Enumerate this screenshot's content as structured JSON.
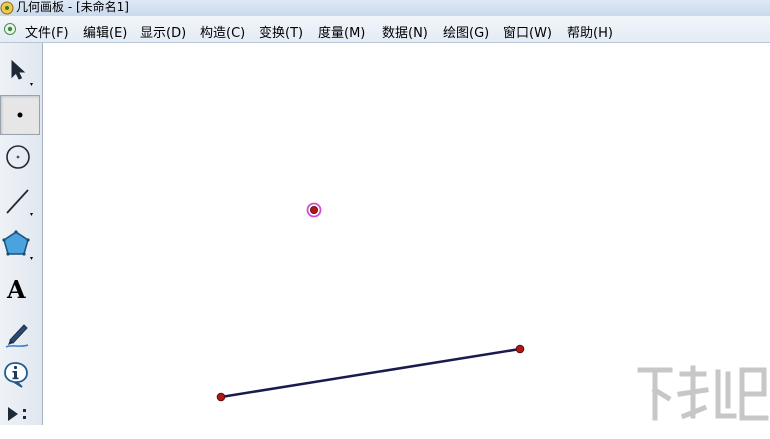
{
  "window": {
    "title": "几何画板 - [未命名1]"
  },
  "menu": {
    "items": [
      {
        "label": "文件(F)"
      },
      {
        "label": "编辑(E)"
      },
      {
        "label": "显示(D)"
      },
      {
        "label": "构造(C)"
      },
      {
        "label": "变换(T)"
      },
      {
        "label": "度量(M)"
      },
      {
        "label": "数据(N)"
      },
      {
        "label": "绘图(G)"
      },
      {
        "label": "窗口(W)"
      },
      {
        "label": "帮助(H)"
      }
    ]
  },
  "toolbox": {
    "tools": [
      {
        "name": "arrow-select-tool",
        "icon": "arrow-cursor-icon"
      },
      {
        "name": "point-tool",
        "icon": "point-icon",
        "selected": true
      },
      {
        "name": "compass-tool",
        "icon": "circle-icon"
      },
      {
        "name": "straightedge-tool",
        "icon": "segment-icon"
      },
      {
        "name": "polygon-tool",
        "icon": "pentagon-icon"
      },
      {
        "name": "text-tool",
        "icon": "text-a-icon",
        "glyph": "A"
      },
      {
        "name": "marker-tool",
        "icon": "pen-icon"
      },
      {
        "name": "information-tool",
        "icon": "info-icon"
      },
      {
        "name": "custom-tool",
        "icon": "play-more-icon"
      }
    ]
  },
  "colors": {
    "segment": "#1a1a4e",
    "point_fill": "#b01818",
    "selected_point_halo": "#d34bd3",
    "canvas_bg": "#ffffff"
  }
}
